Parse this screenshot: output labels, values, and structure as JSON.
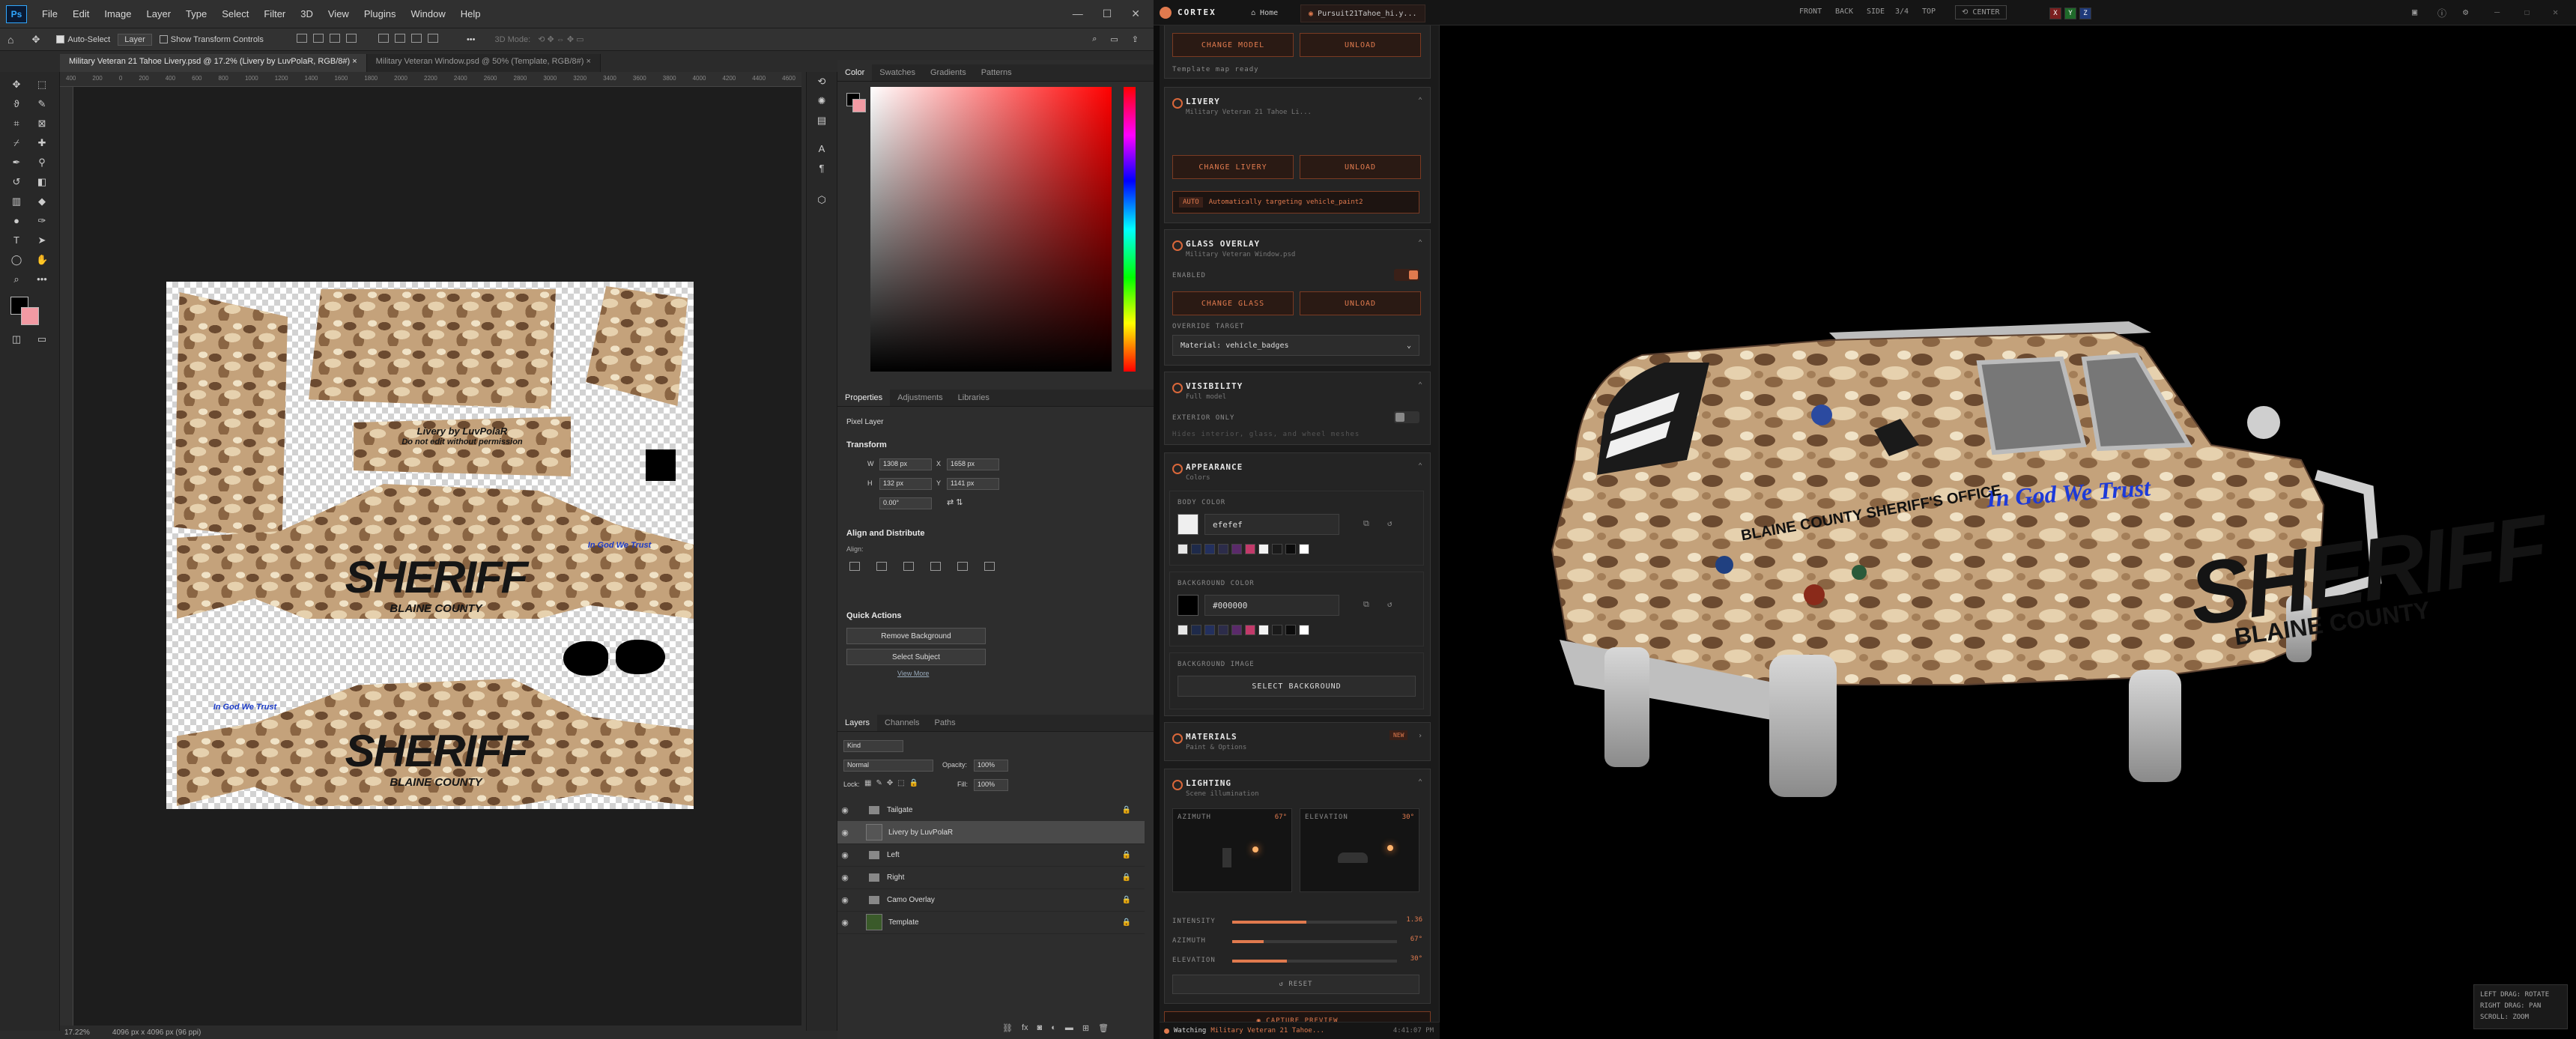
{
  "ps": {
    "menu": [
      "File",
      "Edit",
      "Image",
      "Layer",
      "Type",
      "Select",
      "Filter",
      "3D",
      "View",
      "Plugins",
      "Window",
      "Help"
    ],
    "options": {
      "auto_select": "Auto-Select",
      "layer_select": "Layer",
      "show_transform": "Show Transform Controls",
      "mode_3d": "3D Mode:"
    },
    "tabs": [
      "Military Veteran 21 Tahoe Livery.psd @ 17.2% (Livery by LuvPolaR, RGB/8#)",
      "Military Veteran Window.psd @ 50% (Template, RGB/8#)"
    ],
    "ruler_marks": [
      "400",
      "200",
      "0",
      "200",
      "400",
      "600",
      "800",
      "1000",
      "1200",
      "1400",
      "1600",
      "1800",
      "2000",
      "2200",
      "2400",
      "2600",
      "2800",
      "3000",
      "3200",
      "3400",
      "3600",
      "3800",
      "4000",
      "4200",
      "4400",
      "4600"
    ],
    "status": {
      "zoom": "17.22%",
      "size": "4096 px x 4096 px (96 ppi)"
    },
    "color_tabs": [
      "Color",
      "Swatches",
      "Gradients",
      "Patterns"
    ],
    "prop_tabs": [
      "Properties",
      "Adjustments",
      "Libraries"
    ],
    "properties": {
      "kind": "Pixel Layer",
      "transform": "Transform",
      "w_label": "W",
      "w": "1308 px",
      "x_label": "X",
      "x": "1658 px",
      "h_label": "H",
      "h": "132 px",
      "y_label": "Y",
      "y": "1141 px",
      "angle": "0.00°",
      "align_title": "Align and Distribute",
      "align_sub": "Align:",
      "quick_title": "Quick Actions",
      "remove_bg": "Remove Background",
      "select_subject": "Select Subject",
      "view_more": "View More"
    },
    "layer_tabs": [
      "Layers",
      "Channels",
      "Paths"
    ],
    "layers_ctrl": {
      "kind": "Kind",
      "blend": "Normal",
      "opacity_label": "Opacity:",
      "opacity": "100%",
      "lock_label": "Lock:",
      "fill_label": "Fill:",
      "fill": "100%"
    },
    "layers": [
      {
        "name": "Tailgate",
        "type": "group",
        "locked": true
      },
      {
        "name": "Livery by LuvPolaR",
        "type": "pixel",
        "locked": false,
        "selected": true
      },
      {
        "name": "Left",
        "type": "group",
        "locked": true
      },
      {
        "name": "Right",
        "type": "group",
        "locked": true
      },
      {
        "name": "Camo Overlay",
        "type": "group",
        "locked": true
      },
      {
        "name": "Template",
        "type": "pixel",
        "locked": true
      }
    ],
    "livery_text": {
      "sheriff": "SHERIFF",
      "county": "BLAINE COUNTY",
      "credit1": "Livery by LuvPolaR",
      "credit2": "Do not edit without permission",
      "motto": "In God We Trust"
    }
  },
  "cortex": {
    "brand": "CORTEX",
    "tab_home": "Home",
    "tab_file": "Pursuit21Tahoe_hi.y...",
    "views": [
      "FRONT",
      "BACK",
      "SIDE",
      "3/4",
      "TOP"
    ],
    "center": "CENTER",
    "axes": [
      "X",
      "Y",
      "Z"
    ],
    "model_card": {
      "change": "CHANGE MODEL",
      "unload": "UNLOAD",
      "status": "Template map ready"
    },
    "livery_card": {
      "title": "LIVERY",
      "sub": "Military Veteran 21 Tahoe Li...",
      "change": "CHANGE LIVERY",
      "unload": "UNLOAD",
      "auto_tag": "AUTO",
      "auto_text": "Automatically targeting vehicle_paint2"
    },
    "glass_card": {
      "title": "GLASS OVERLAY",
      "sub": "Military Veteran Window.psd",
      "enabled": "ENABLED",
      "change": "CHANGE GLASS",
      "unload": "UNLOAD",
      "override": "OVERRIDE TARGET",
      "material": "Material: vehicle_badges"
    },
    "visibility_card": {
      "title": "VISIBILITY",
      "sub": "Full model",
      "exterior": "EXTERIOR ONLY",
      "hint": "Hides interior, glass, and wheel meshes"
    },
    "appearance_card": {
      "title": "APPEARANCE",
      "sub": "Colors",
      "body_label": "BODY COLOR",
      "body_hex": "efefef",
      "bg_label": "BACKGROUND COLOR",
      "bg_hex": "#000000",
      "bg_image_label": "BACKGROUND IMAGE",
      "select_bg": "SELECT BACKGROUND"
    },
    "swatches": [
      "#e6e6e6",
      "#1e2a4a",
      "#23305e",
      "#2c2c4a",
      "#5a2a6a",
      "#c23a6a",
      "#f2f2f2",
      "#1a1a1a",
      "#0b0b0b",
      "#ffffff"
    ],
    "materials_card": {
      "title": "MATERIALS",
      "sub": "Paint & Options",
      "badge": "NEW"
    },
    "lighting_card": {
      "title": "LIGHTING",
      "sub": "Scene illumination",
      "azimuth_label": "AZIMUTH",
      "azimuth": "67°",
      "elevation_label": "ELEVATION",
      "elevation": "30°",
      "intensity_label": "INTENSITY",
      "intensity": "1.36",
      "reset": "RESET"
    },
    "sliders": {
      "intensity": 0.45,
      "azimuth": 0.19,
      "elevation": 0.33
    },
    "capture": "CAPTURE PREVIEW",
    "watch_label": "Watching",
    "watch_file": "Military Veteran 21 Tahoe...",
    "watch_time": "4:41:07 PM",
    "hints": [
      "LEFT DRAG: ROTATE",
      "RIGHT DRAG: PAN",
      "SCROLL: ZOOM"
    ],
    "decal": {
      "sheriff": "SHERIFF",
      "county": "BLAINE COUNTY",
      "motto": "In God We Trust",
      "office": "BLAINE COUNTY SHERIFF'S OFFICE"
    }
  },
  "colors": {
    "accent": "#e07a4e",
    "ps_blue": "#31a8ff",
    "camo_dark": "#6b4a30",
    "camo_mid": "#c4a27b",
    "camo_light": "#e6d1ae"
  }
}
